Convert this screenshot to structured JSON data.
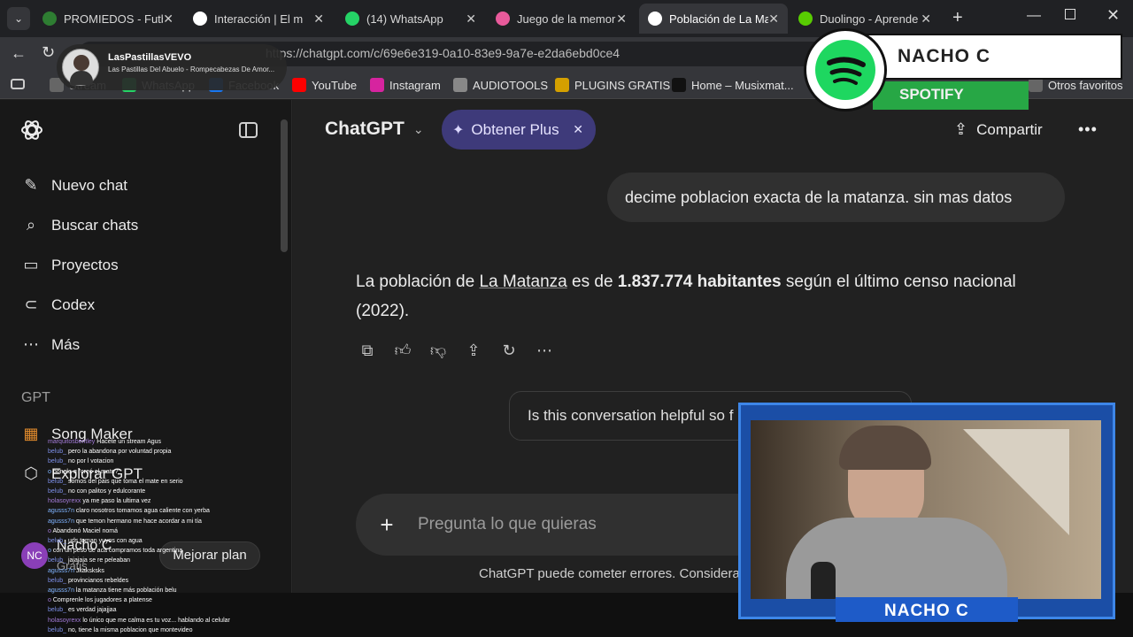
{
  "browser": {
    "tabs": [
      {
        "title": "PROMIEDOS - Futbol",
        "icon": "soccer-ball-icon",
        "color": "#2e7d32"
      },
      {
        "title": "Interacción | El m",
        "icon": "discord-icon",
        "color": "#ffffff"
      },
      {
        "title": "(14) WhatsApp",
        "icon": "whatsapp-icon",
        "color": "#25d366"
      },
      {
        "title": "Juego de la memoria",
        "icon": "game-icon",
        "color": "#e85a9b"
      },
      {
        "title": "Población de La Mata",
        "icon": "chatgpt-icon",
        "color": "#ffffff"
      },
      {
        "title": "Duolingo - Aprende",
        "icon": "duolingo-icon",
        "color": "#58cc02"
      }
    ],
    "url": "https://chatgpt.com/c/69e6e319-0a10-83e9-9a7e-e2da6ebd0ce4",
    "bookmarks": [
      {
        "label": "Stream",
        "icon": "folder-icon"
      },
      {
        "label": "WhatsApp",
        "icon": "whatsapp-icon"
      },
      {
        "label": "Facebook",
        "icon": "facebook-icon"
      },
      {
        "label": "YouTube",
        "icon": "youtube-icon"
      },
      {
        "label": "Instagram",
        "icon": "instagram-icon"
      },
      {
        "label": "AUDIOTOOLS",
        "icon": "audiotools-icon"
      },
      {
        "label": "PLUGINS GRATIS",
        "icon": "plugins-icon"
      },
      {
        "label": "Home – Musixmat...",
        "icon": "musixmatch-icon"
      },
      {
        "label": "Otros favoritos",
        "icon": "folder-icon"
      }
    ]
  },
  "media_overlay": {
    "channel": "LasPastillasVEVO",
    "track": "Las Pastillas Del Abuelo - Rompecabezas De Amor..."
  },
  "sidebar": {
    "items": [
      {
        "label": "Nuevo chat",
        "icon": "edit-icon"
      },
      {
        "label": "Buscar chats",
        "icon": "search-icon"
      },
      {
        "label": "Proyectos",
        "icon": "folder-plus-icon"
      },
      {
        "label": "Codex",
        "icon": "codex-icon"
      },
      {
        "label": "Más",
        "icon": "more-icon"
      }
    ],
    "section_label": "GPT",
    "gpts": [
      {
        "label": "Song Maker",
        "icon": "song-maker-icon"
      },
      {
        "label": "Explorar GPT",
        "icon": "cube-icon"
      }
    ],
    "user": {
      "initials": "NC",
      "name": "Nacho C",
      "plan": "Gratis",
      "upgrade_label": "Mejorar plan"
    }
  },
  "header": {
    "model": "ChatGPT",
    "plus_button": "Obtener Plus",
    "share_label": "Compartir"
  },
  "conversation": {
    "user_message": "decime poblacion exacta de la matanza. sin mas datos",
    "answer_prefix": "La población de ",
    "answer_link": "La Matanza",
    "answer_mid": " es de ",
    "answer_bold": "1.837.774 habitantes",
    "answer_suffix": " según el último censo nacional (2022).",
    "actions": [
      "copy-icon",
      "thumbs-up-icon",
      "thumbs-down-icon",
      "share-icon",
      "regenerate-icon",
      "more-icon"
    ],
    "feedback": "Is this conversation helpful so f",
    "composer_placeholder": "Pregunta lo que quieras",
    "disclaimer": "ChatGPT puede cometer errores. Considera v"
  },
  "spotify_overlay": {
    "name": "NACHO C",
    "label": "SPOTIFY"
  },
  "webcam_overlay": {
    "name": "NACHO C"
  },
  "stream_chat": [
    {
      "user": "marquitosbentley",
      "text": "Hacete un stream Agus",
      "c": "n1"
    },
    {
      "user": "belub_",
      "text": "pero la abandona por voluntad propia",
      "c": "n2"
    },
    {
      "user": "belub_",
      "text": "no por l votacion",
      "c": "n2"
    },
    {
      "user": "o",
      "text": "ponele q \"creó el mate?\"",
      "c": "n3"
    },
    {
      "user": "belub_",
      "text": "somos del pais que toma el mate en serio",
      "c": "n2"
    },
    {
      "user": "belub_",
      "text": "no con palitos y edulcorante",
      "c": "n2"
    },
    {
      "user": "holasoyrexx",
      "text": "ya me paso la ultima vez",
      "c": "n1"
    },
    {
      "user": "agusss7n",
      "text": "claro nosotros tomamos agua caliente con yerba",
      "c": "n3"
    },
    {
      "user": "agusss7n",
      "text": "que temon hermano me hace acordar a mi tía",
      "c": "n3"
    },
    {
      "user": "o",
      "text": "Abandonó Maciel nomá",
      "c": "n1"
    },
    {
      "user": "belub_",
      "text": "uds toman yuyos con agua",
      "c": "n2"
    },
    {
      "user": "o",
      "text": "con un peso de aca compramos toda argentina",
      "c": "n3"
    },
    {
      "user": "belub_",
      "text": "jajajaja se re peleaban",
      "c": "n2"
    },
    {
      "user": "agusss7n",
      "text": "Jkaksksks",
      "c": "n3"
    },
    {
      "user": "belub_",
      "text": "provincianos rebeldes",
      "c": "n2"
    },
    {
      "user": "agusss7n",
      "text": "la matanza tiene más población belu",
      "c": "n3"
    },
    {
      "user": "o",
      "text": "Comprenle los jugadores a platense",
      "c": "n1"
    },
    {
      "user": "belub_",
      "text": "es verdad jajajjaa",
      "c": "n2"
    },
    {
      "user": "holasoyrexx",
      "text": "lo único que me calma es tu voz... hablando al celular",
      "c": "n1"
    },
    {
      "user": "belub_",
      "text": "no, tiene la misma poblacion que montevideo",
      "c": "n2"
    }
  ]
}
